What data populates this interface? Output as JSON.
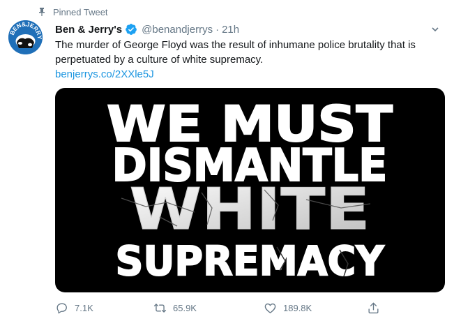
{
  "pinned": {
    "label": "Pinned Tweet",
    "icon": "pin-icon"
  },
  "tweet": {
    "author_name": "Ben & Jerry's",
    "verified_icon": "verified-badge-icon",
    "handle": "@benandjerrys",
    "separator": "·",
    "time": "21h",
    "text": "The murder of George Floyd was the result of inhumane police brutality that is perpetuated by a culture of white supremacy.",
    "link": "benjerrys.co/2XXle5J",
    "avatar_logo_text": "BEN&JERRY'S"
  },
  "media": {
    "lines": [
      "WE MUST",
      "DISMANTLE",
      "WHITE",
      "SUPREMACY"
    ]
  },
  "actions": {
    "reply_count": "7.1K",
    "retweet_count": "65.9K",
    "like_count": "189.8K"
  },
  "colors": {
    "link": "#1b95e0",
    "muted": "#657786",
    "verified": "#1da1f2",
    "avatar_bg": "#1f6fb8"
  }
}
